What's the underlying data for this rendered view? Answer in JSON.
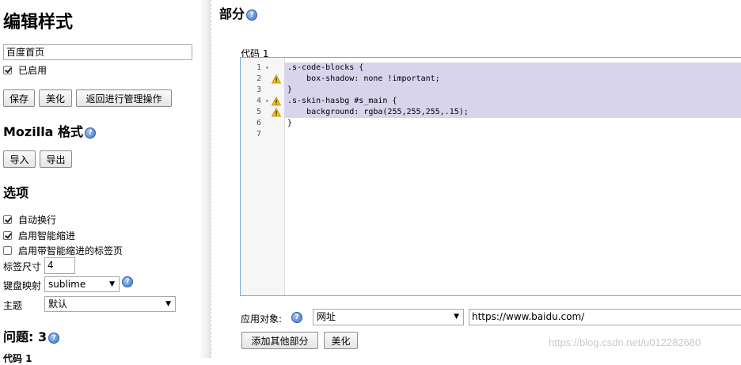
{
  "sidebar": {
    "title": "编辑样式",
    "style_name": "百度首页",
    "enabled_label": "已启用",
    "buttons": {
      "save": "保存",
      "beautify": "美化",
      "back": "返回进行管理操作"
    },
    "mozilla": {
      "heading": "Mozilla 格式",
      "import": "导入",
      "export": "导出"
    },
    "options": {
      "heading": "选项",
      "word_wrap": "自动换行",
      "smart_indent": "启用智能缩进",
      "smart_indent_tabs": "启用带智能缩进的标签页",
      "tab_size_label": "标签尺寸",
      "tab_size_value": "4",
      "keymap_label": "键盘映射",
      "keymap_value": "sublime",
      "theme_label": "主题",
      "theme_value": "默认"
    },
    "issues": {
      "heading": "问题: 3",
      "partial": "代码 1"
    }
  },
  "main": {
    "title": "部分",
    "code_label": "代码 1",
    "lines": [
      {
        "n": "1",
        "fold": "▾",
        "warn": false,
        "code": ".s-code-blocks {"
      },
      {
        "n": "2",
        "fold": "",
        "warn": true,
        "code": "    box-shadow: none !important;"
      },
      {
        "n": "3",
        "fold": "",
        "warn": false,
        "code": "}"
      },
      {
        "n": "4",
        "fold": "▾",
        "warn": true,
        "code": ".s-skin-hasbg #s_main {"
      },
      {
        "n": "5",
        "fold": "",
        "warn": true,
        "code": "    background: rgba(255,255,255,.15);"
      },
      {
        "n": "6",
        "fold": "",
        "warn": false,
        "code": "}"
      },
      {
        "n": "7",
        "fold": "",
        "warn": false,
        "code": ""
      }
    ],
    "apply_label": "应用对象:",
    "apply_type": "网址",
    "apply_value": "https://www.baidu.com/",
    "add_section": "添加其他部分",
    "beautify": "美化"
  },
  "watermark": "https://blog.csdn.net/u012282680",
  "icons": {
    "help": "help-icon",
    "warning": "warning-icon",
    "checkbox": "checkbox-icon"
  }
}
